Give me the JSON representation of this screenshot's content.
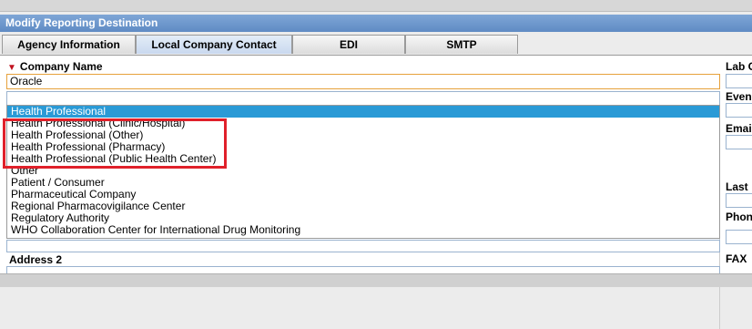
{
  "window": {
    "title": "Modify Reporting Destination"
  },
  "tabs": [
    {
      "label": "Agency Information"
    },
    {
      "label": "Local Company Contact"
    },
    {
      "label": "EDI"
    },
    {
      "label": "SMTP"
    }
  ],
  "form": {
    "company_name_label": "Company Name",
    "company_name_value": "Oracle",
    "address2_label": "Address 2"
  },
  "dropdown": {
    "options": [
      "Health Professional",
      "Health Professional (Clinic/Hospital)",
      "Health Professional (Other)",
      "Health Professional (Pharmacy)",
      "Health Professional (Public Health Center)",
      "Other",
      "Patient / Consumer",
      "Pharmaceutical Company",
      "Regional Pharmacovigilance Center",
      "Regulatory Authority",
      "WHO Collaboration Center for International Drug Monitoring"
    ],
    "selected": "Health Professional"
  },
  "right_labels": {
    "lab": "Lab C",
    "event": "Even",
    "email": "Emai",
    "last": "Last",
    "phone": "Phon",
    "fax": "FAX"
  },
  "colors": {
    "selected": "#2a9ad6",
    "highlight_box": "#e0202a",
    "title_bar": "#6d96cc"
  }
}
